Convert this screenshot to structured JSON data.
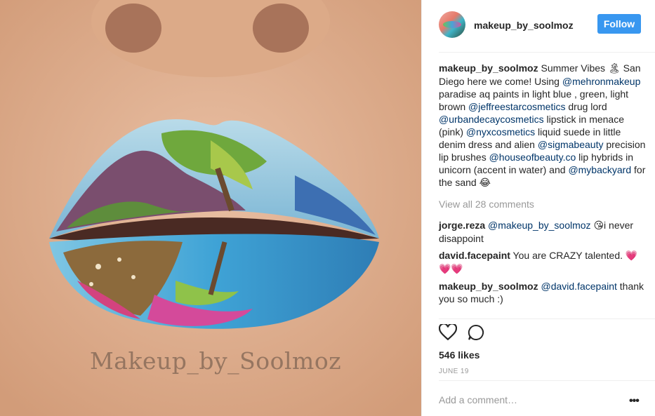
{
  "post": {
    "username": "makeup_by_soolmoz",
    "follow_label": "Follow",
    "watermark": "Makeup_by_Soolmoz",
    "caption": {
      "user": "makeup_by_soolmoz",
      "t1": "Summer Vibes ",
      "e1": "🏝",
      "t2": " San Diego here we come! Using ",
      "m1": "@mehronmakeup",
      "t3": " paradise aq paints in light blue , green, light brown ",
      "m2": "@jeffreestarcosmetics",
      "t4": " drug lord ",
      "m3": "@urbandecaycosmetics",
      "t5": " lipstick in menace (pink) ",
      "m4": "@nyxcosmetics",
      "t6": " liquid suede in little denim dress and alien ",
      "m5": "@sigmabeauty",
      "t7": " precision lip brushes ",
      "m6": "@houseofbeauty.co",
      "t8": " lip hybrids in unicorn (accent in water) and ",
      "m7": "@mybackyard",
      "t9": " for the sand ",
      "e2": "😂"
    },
    "view_all": "View all 28 comments",
    "comments": [
      {
        "user": "jorge.reza",
        "mention": "@makeup_by_soolmoz",
        "text_a": " ",
        "emoji": "😘",
        "text_b": "i never disappoint"
      },
      {
        "user": "david.facepaint",
        "text_a": " You are CRAZY talented. ",
        "emoji": "💗💗💗"
      },
      {
        "user": "makeup_by_soolmoz",
        "mention": "@david.facepaint",
        "text_a": " thank you so much :)"
      }
    ],
    "likes": "546 likes",
    "date": "JUNE 19",
    "add_comment_placeholder": "Add a comment…",
    "more_label": "•••"
  },
  "icons": {
    "like": "heart-icon",
    "comment": "comment-bubble-icon",
    "options": "more-options-icon"
  }
}
